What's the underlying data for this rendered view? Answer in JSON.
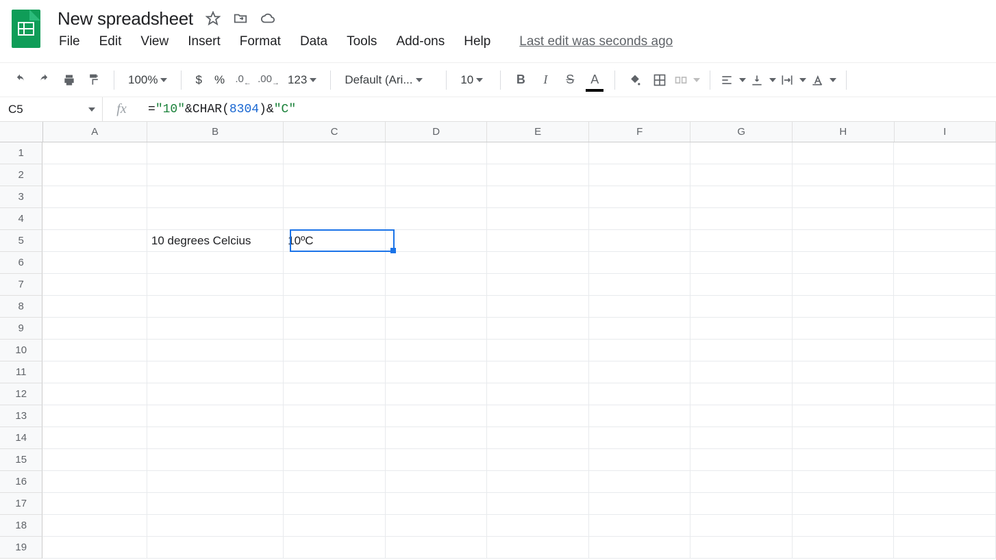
{
  "doc": {
    "title": "New spreadsheet"
  },
  "menubar": {
    "file": "File",
    "edit": "Edit",
    "view": "View",
    "insert": "Insert",
    "format": "Format",
    "data": "Data",
    "tools": "Tools",
    "addons": "Add-ons",
    "help": "Help",
    "last_edit": "Last edit was seconds ago"
  },
  "toolbar": {
    "zoom": "100%",
    "currency": "$",
    "percent": "%",
    "dec_decrease": ".0",
    "dec_increase": ".00",
    "more_formats": "123",
    "font": "Default (Ari...",
    "font_size": "10"
  },
  "namebox": {
    "value": "C5"
  },
  "formula": {
    "raw": "=\"10\"&CHAR(8304)&\"C\"",
    "parts": {
      "eq": "=",
      "p1": "\"10\"",
      "amp1": "&",
      "fn": "CHAR",
      "lp": "(",
      "num": "8304",
      "rp": ")",
      "amp2": "&",
      "p3": "\"C\""
    }
  },
  "columns": [
    "A",
    "B",
    "C",
    "D",
    "E",
    "F",
    "G",
    "H",
    "I"
  ],
  "rows": [
    1,
    2,
    3,
    4,
    5,
    6,
    7,
    8,
    9,
    10,
    11,
    12,
    13,
    14,
    15,
    16,
    17,
    18,
    19
  ],
  "cells": {
    "B5": "10 degrees Celcius",
    "C5": "10ºC"
  },
  "selection": {
    "cell": "C5",
    "row_index": 4,
    "col_index": 2
  }
}
